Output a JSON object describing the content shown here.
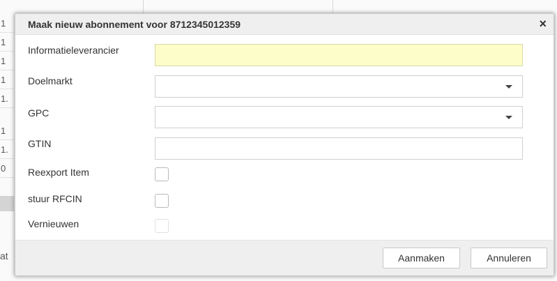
{
  "background": {
    "rows": [
      "1",
      "1",
      "1",
      "1",
      "1.",
      "1",
      "1.",
      "0"
    ],
    "footer_fragment": "at"
  },
  "dialog": {
    "title": "Maak nieuw abonnement voor 8712345012359",
    "close_icon": "×",
    "fields": {
      "informatieleverancier": {
        "label": "Informatieleverancier",
        "value": ""
      },
      "doelmarkt": {
        "label": "Doelmarkt",
        "value": ""
      },
      "gpc": {
        "label": "GPC",
        "value": ""
      },
      "gtin": {
        "label": "GTIN",
        "value": ""
      }
    },
    "checkboxes": {
      "reexport": {
        "label": "Reexport Item",
        "checked": false
      },
      "rfcin": {
        "label": "stuur RFCIN",
        "checked": false
      },
      "vernieuwen": {
        "label": "Vernieuwen",
        "checked": false,
        "disabled": true
      }
    },
    "buttons": {
      "create": "Aanmaken",
      "cancel": "Annuleren"
    }
  },
  "colors": {
    "highlight_field": "#fdfdc9",
    "header_bg": "#efefef"
  }
}
